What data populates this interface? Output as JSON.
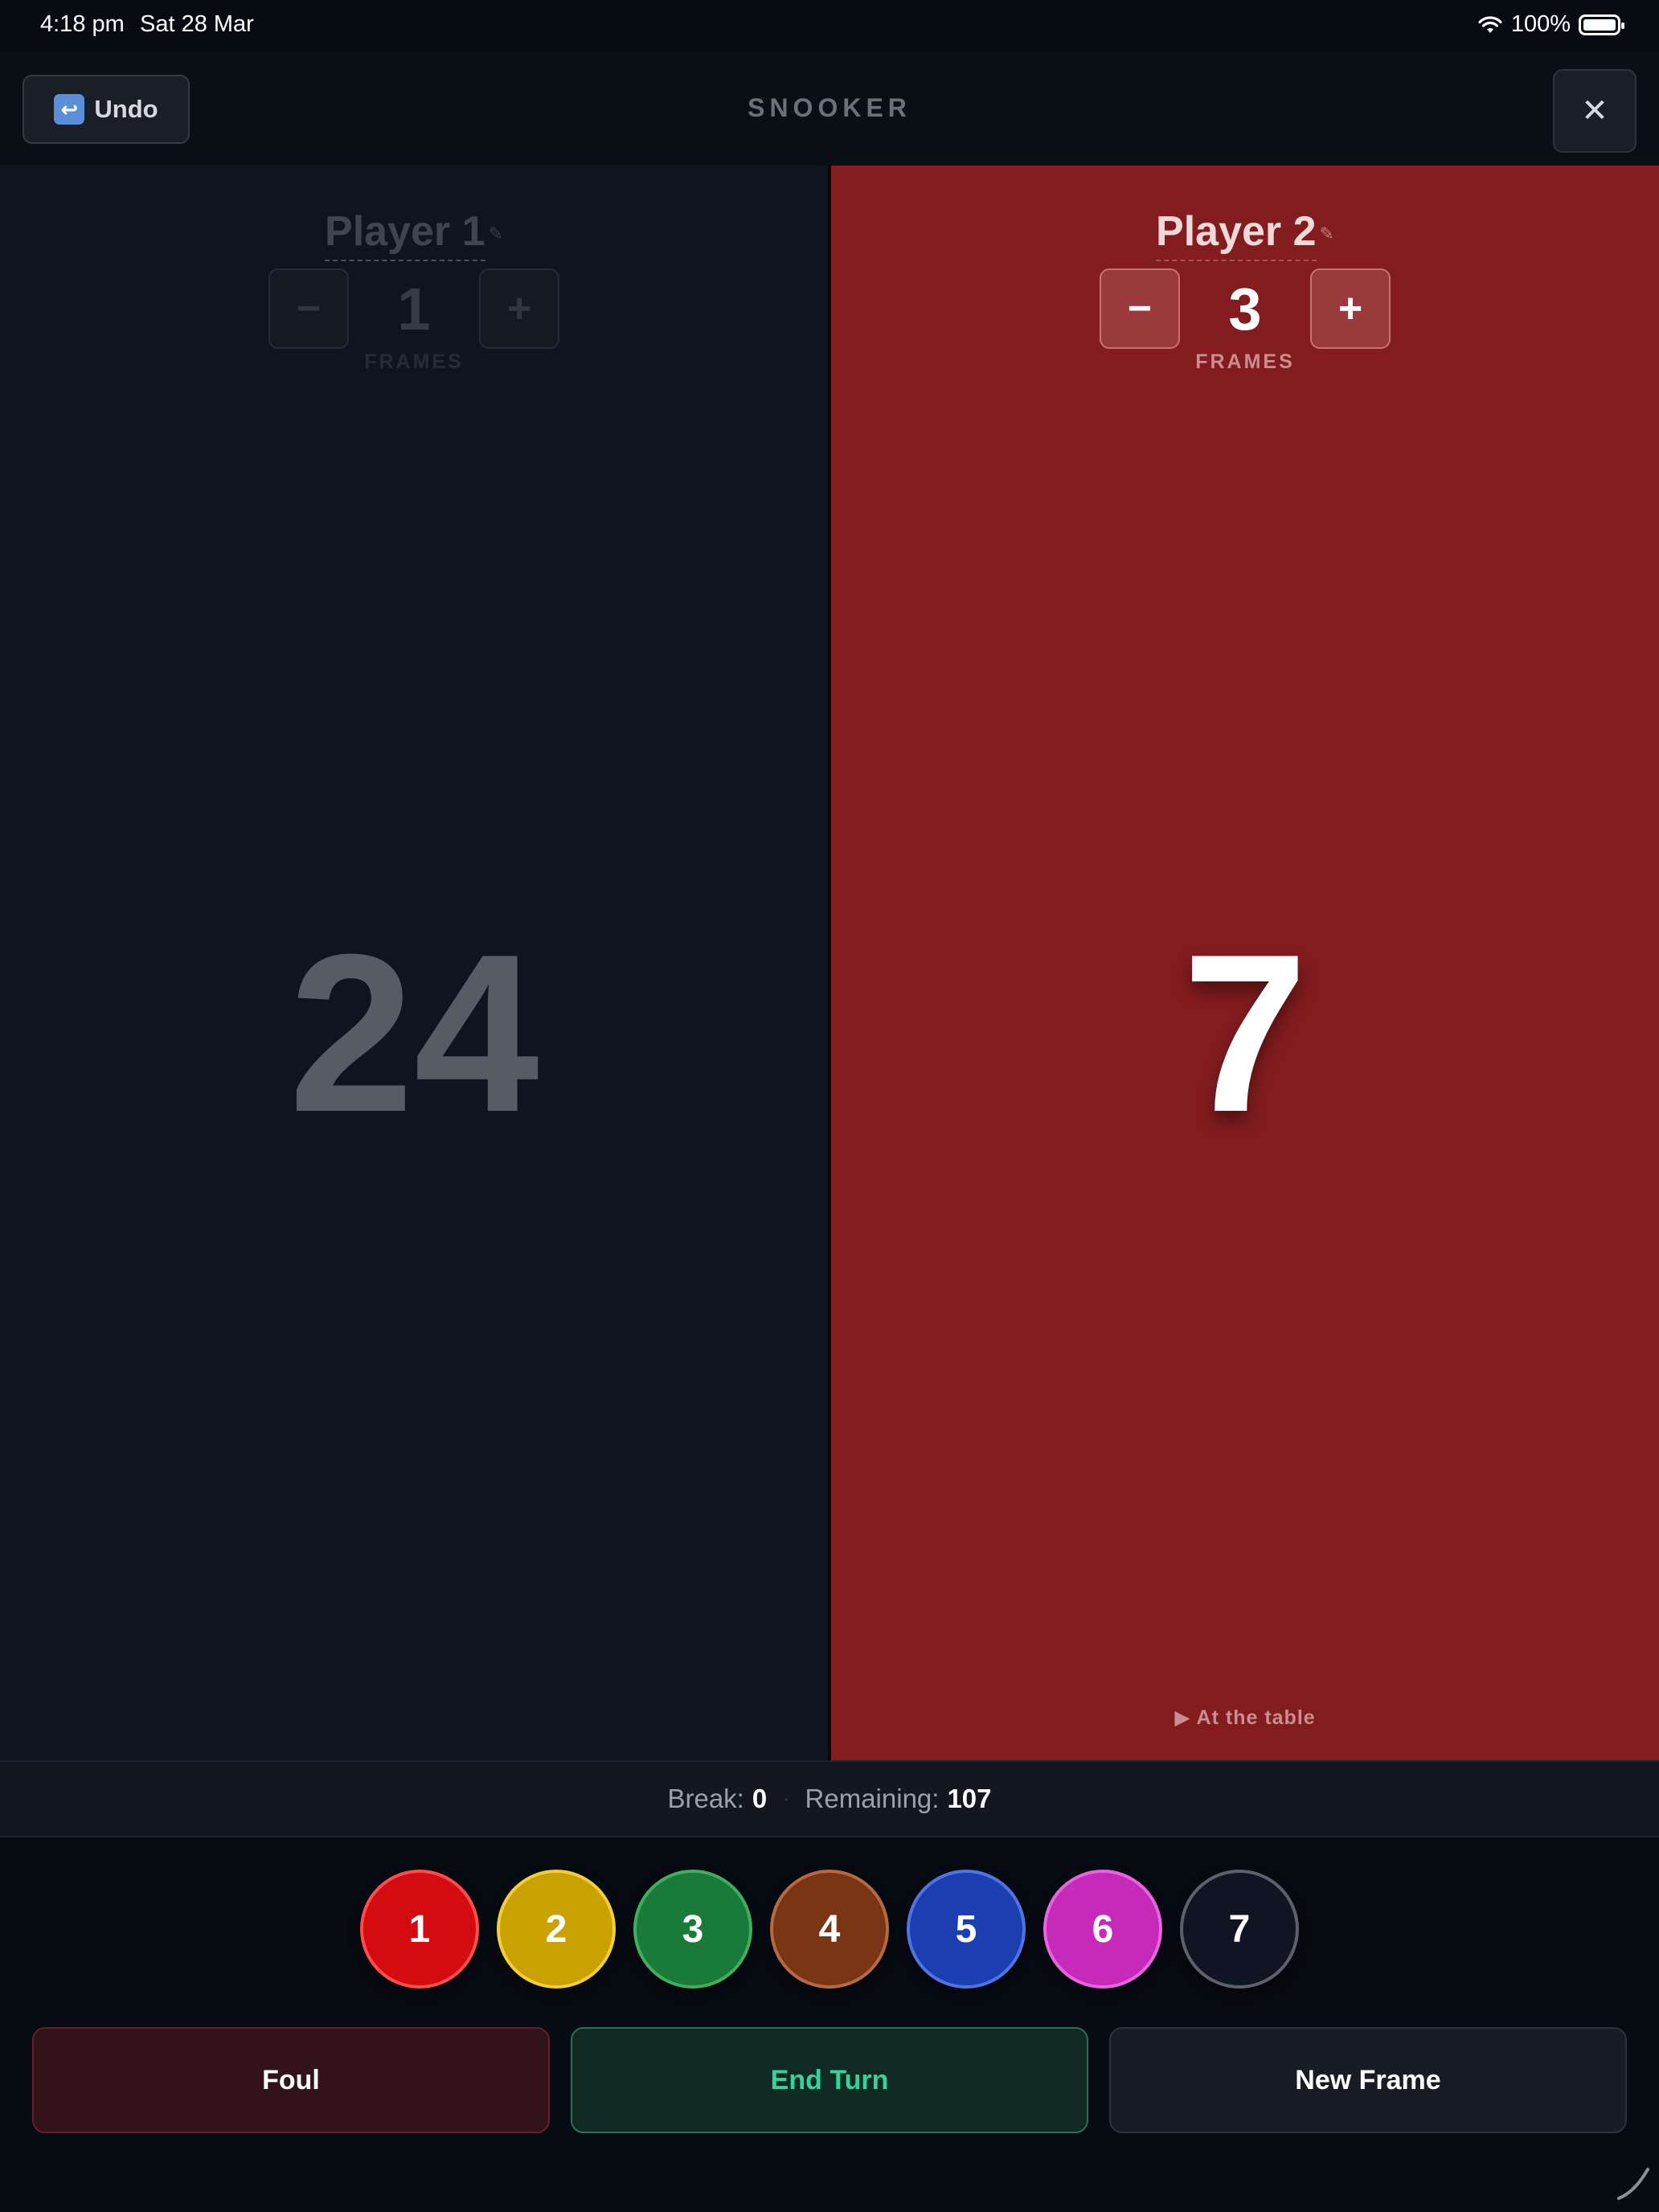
{
  "status_bar": {
    "time": "4:18 pm",
    "date": "Sat 28 Mar",
    "battery": "100%"
  },
  "header": {
    "undo_label": "Undo",
    "undo_icon": "↩",
    "title": "SNOOKER",
    "close_label": "✕"
  },
  "players": [
    {
      "name": "Player 1",
      "frames": "1",
      "frames_label": "FRAMES",
      "score": "24",
      "minus": "−",
      "plus": "+"
    },
    {
      "name": "Player 2",
      "frames": "3",
      "frames_label": "FRAMES",
      "score": "7",
      "minus": "−",
      "plus": "+",
      "status": "▶ At the table"
    }
  ],
  "info": {
    "break_label": "Break:",
    "break_value": "0",
    "separator": "·",
    "remaining_label": "Remaining:",
    "remaining_value": "107"
  },
  "balls": [
    {
      "label": "1",
      "color": "#d40c10",
      "border": "#ff4d4d"
    },
    {
      "label": "2",
      "color": "#c9a100",
      "border": "#f2cf3a"
    },
    {
      "label": "3",
      "color": "#1a7a3a",
      "border": "#3fae5e"
    },
    {
      "label": "4",
      "color": "#7a3614",
      "border": "#b66a42"
    },
    {
      "label": "5",
      "color": "#1b3eb0",
      "border": "#4f74e6"
    },
    {
      "label": "6",
      "color": "#c52bb8",
      "border": "#e865dd"
    },
    {
      "label": "7",
      "color": "#0f1522",
      "border": "#5b616d"
    }
  ],
  "actions": {
    "foul": "Foul",
    "end_turn": "End Turn",
    "new_frame": "New Frame"
  }
}
